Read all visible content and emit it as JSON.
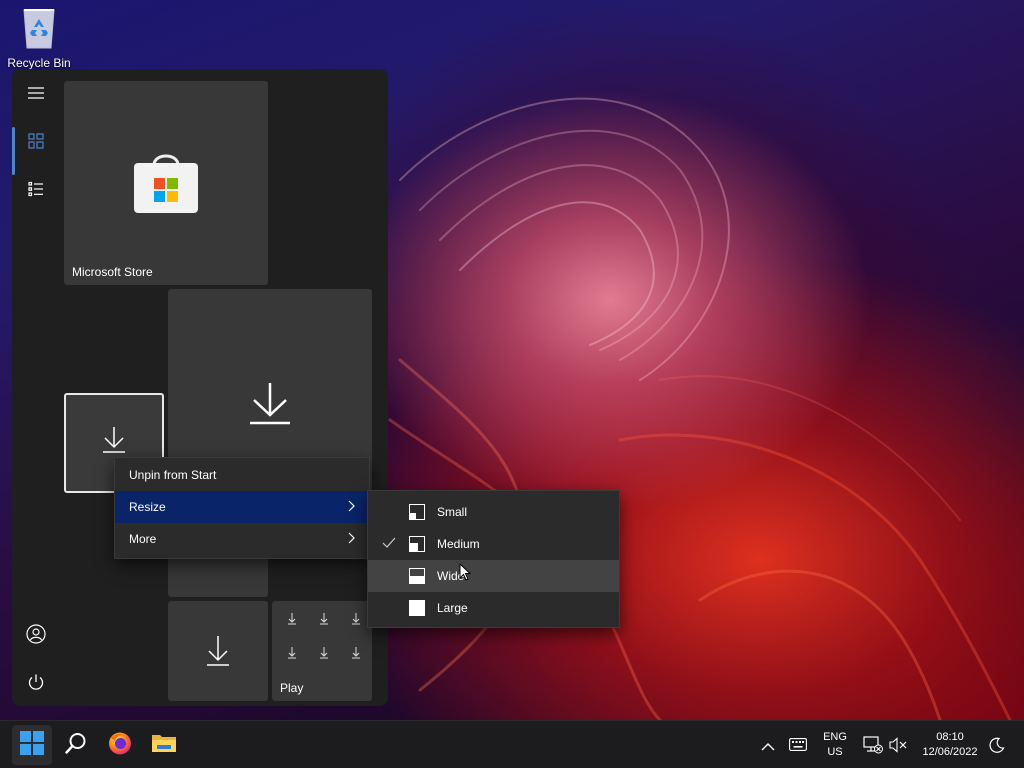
{
  "desktop": {
    "recycle_bin_label": "Recycle Bin"
  },
  "start_menu": {
    "rail": {
      "icons": [
        "hamburger-menu-icon",
        "tiles-view-icon",
        "all-apps-list-icon",
        "user-account-icon",
        "power-icon"
      ]
    },
    "tiles": {
      "store_label": "Microsoft Store",
      "play_label": "Play"
    }
  },
  "context_menu": {
    "items": [
      {
        "label": "Unpin from Start"
      },
      {
        "label": "Resize",
        "has_submenu": true,
        "highlighted": true
      },
      {
        "label": "More",
        "has_submenu": true
      }
    ]
  },
  "resize_submenu": {
    "items": [
      {
        "label": "Small",
        "checked": false
      },
      {
        "label": "Medium",
        "checked": true
      },
      {
        "label": "Wide",
        "checked": false,
        "hovered": true
      },
      {
        "label": "Large",
        "checked": false
      }
    ]
  },
  "taskbar": {
    "icons": [
      "start-icon",
      "search-icon",
      "firefox-icon",
      "file-explorer-icon"
    ],
    "tray": {
      "language": "ENG",
      "region": "US",
      "time": "08:10",
      "date": "12/06/2022"
    }
  },
  "colors": {
    "menu_highlight": "#0a246a",
    "rail_accent": "#4c86c9",
    "tile_bg": "#383838",
    "start_bg": "#1f1f1f"
  }
}
